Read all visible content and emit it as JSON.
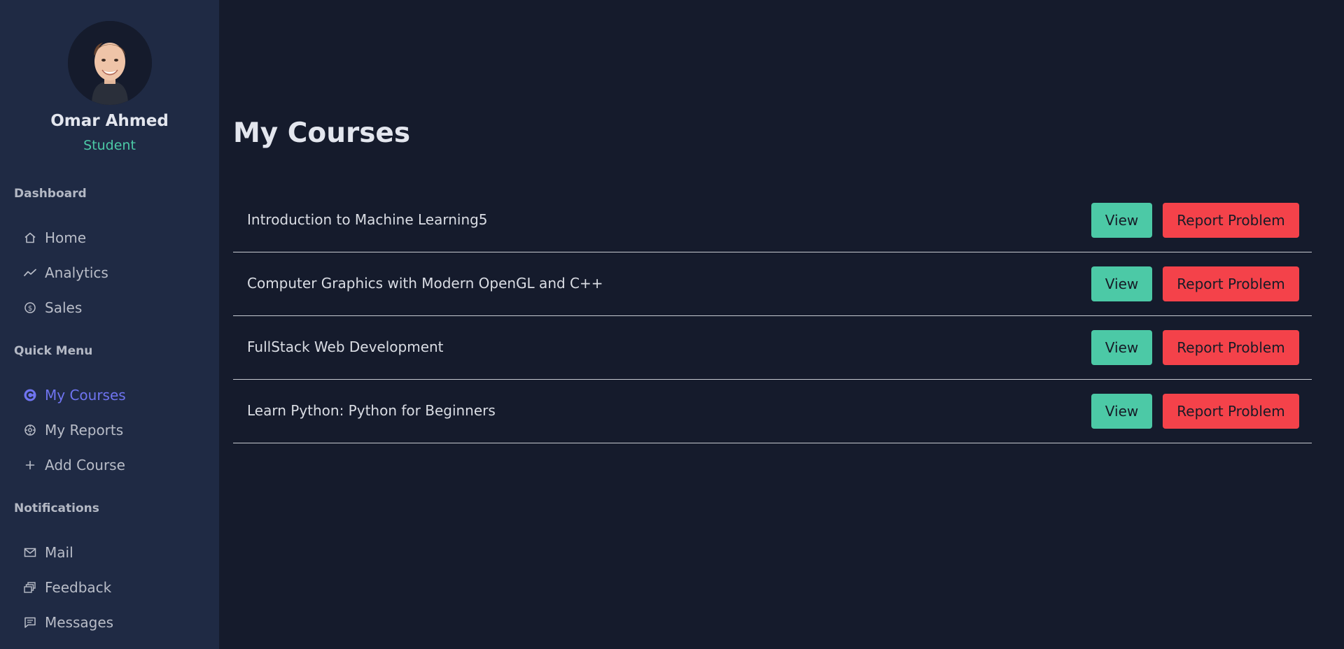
{
  "user": {
    "name": "Omar Ahmed",
    "role": "Student"
  },
  "sidebar": {
    "sections": [
      {
        "title": "Dashboard",
        "items": [
          {
            "label": "Home",
            "icon": "home-icon"
          },
          {
            "label": "Analytics",
            "icon": "trend-line-icon"
          },
          {
            "label": "Sales",
            "icon": "dollar-circle-icon"
          }
        ]
      },
      {
        "title": "Quick Menu",
        "items": [
          {
            "label": "My Courses",
            "icon": "courses-circle-icon",
            "active": true
          },
          {
            "label": "My Reports",
            "icon": "reports-gear-icon"
          },
          {
            "label": "Add Course",
            "icon": "plus-icon"
          }
        ]
      },
      {
        "title": "Notifications",
        "items": [
          {
            "label": "Mail",
            "icon": "mail-icon"
          },
          {
            "label": "Feedback",
            "icon": "feedback-icon"
          },
          {
            "label": "Messages",
            "icon": "message-icon"
          }
        ]
      }
    ]
  },
  "main": {
    "title": "My Courses",
    "courses": [
      {
        "name": "Introduction to Machine Learning5",
        "view_label": "View",
        "report_label": "Report Problem"
      },
      {
        "name": "Computer Graphics with Modern OpenGL and C++",
        "view_label": "View",
        "report_label": "Report Problem"
      },
      {
        "name": "FullStack Web Development",
        "view_label": "View",
        "report_label": "Report Problem"
      },
      {
        "name": "Learn Python: Python for Beginners",
        "view_label": "View",
        "report_label": "Report Problem"
      }
    ]
  },
  "colors": {
    "background": "#151b2c",
    "sidebar": "#1f2a44",
    "accent_active": "#6f74f0",
    "view_button": "#4cc9a6",
    "report_button": "#f4424a",
    "role_text": "#4cc9a6"
  }
}
